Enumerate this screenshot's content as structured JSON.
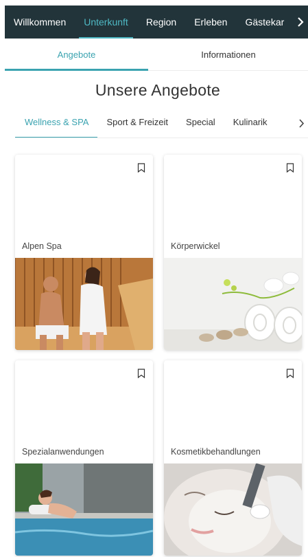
{
  "topnav": {
    "items": [
      {
        "label": "Willkommen",
        "active": false
      },
      {
        "label": "Unterkunft",
        "active": true
      },
      {
        "label": "Region",
        "active": false
      },
      {
        "label": "Erleben",
        "active": false
      },
      {
        "label": "Gästekar",
        "active": false
      }
    ],
    "more_icon": "chevron-right-icon"
  },
  "subtabs": [
    {
      "label": "Angebote",
      "active": true
    },
    {
      "label": "Informationen",
      "active": false
    }
  ],
  "heading": "Unsere Angebote",
  "categories": {
    "items": [
      {
        "label": "Wellness & SPA",
        "active": true
      },
      {
        "label": "Sport & Freizeit",
        "active": false
      },
      {
        "label": "Special",
        "active": false
      },
      {
        "label": "Kulinarik",
        "active": false
      }
    ],
    "more_icon": "chevron-right-icon"
  },
  "offers": [
    {
      "title": "Alpen Spa",
      "icon": "bookmark-icon",
      "image": "sauna-couple"
    },
    {
      "title": "Körperwickel",
      "icon": "bookmark-icon",
      "image": "towels-orchid-stones"
    },
    {
      "title": "Spezialanwendungen",
      "icon": "bookmark-icon",
      "image": "pool-relaxing-woman"
    },
    {
      "title": "Kosmetikbehandlungen",
      "icon": "bookmark-icon",
      "image": "facial-mask-treatment"
    }
  ],
  "colors": {
    "nav_bg": "#22343a",
    "accent": "#3aa3b0"
  }
}
